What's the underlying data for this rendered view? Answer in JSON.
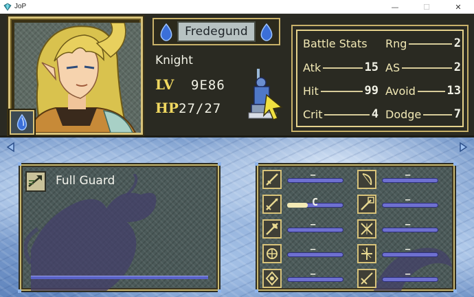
{
  "window": {
    "title": "JoP",
    "minimize_glyph": "—",
    "maximize_glyph": "☐",
    "close_glyph": "✕"
  },
  "unit": {
    "name": "Fredegund",
    "class": "Knight",
    "level_label": "LV",
    "level_value": "9E86",
    "hp_label": "HP",
    "hp_value": "27/27"
  },
  "battle_stats": {
    "title": "Battle Stats",
    "rows": [
      [
        {
          "label": "Rng",
          "value": "2"
        }
      ],
      [
        {
          "label": "Atk",
          "value": "15"
        },
        {
          "label": "AS",
          "value": "2"
        }
      ],
      [
        {
          "label": "Hit",
          "value": "99"
        },
        {
          "label": "Avoid",
          "value": "13"
        }
      ],
      [
        {
          "label": "Crit",
          "value": "4"
        },
        {
          "label": "Dodge",
          "value": "7"
        }
      ]
    ]
  },
  "skill": {
    "name": "Full Guard",
    "icon": "arrow-skill-icon"
  },
  "weapon_ranks": {
    "left": [
      {
        "icon": "sword-rank-icon",
        "rank": "–"
      },
      {
        "icon": "lance-rank-icon",
        "rank": "C"
      },
      {
        "icon": "axe-rank-icon",
        "rank": "–"
      },
      {
        "icon": "anima-rank-icon",
        "rank": "–"
      },
      {
        "icon": "light-rank-icon",
        "rank": "–"
      }
    ],
    "right": [
      {
        "icon": "bow-rank-icon",
        "rank": "–"
      },
      {
        "icon": "staff-rank-icon",
        "rank": "–"
      },
      {
        "icon": "dark-rank-icon",
        "rank": "–"
      },
      {
        "icon": "crossbow-rank-icon",
        "rank": "–"
      },
      {
        "icon": "ballista-rank-icon",
        "rank": "–"
      }
    ]
  },
  "colors": {
    "gold": "#d8c37a",
    "stat_text": "#f2e9b5",
    "level_label": "#f0d860",
    "bar_blue": "#6e70d0"
  }
}
